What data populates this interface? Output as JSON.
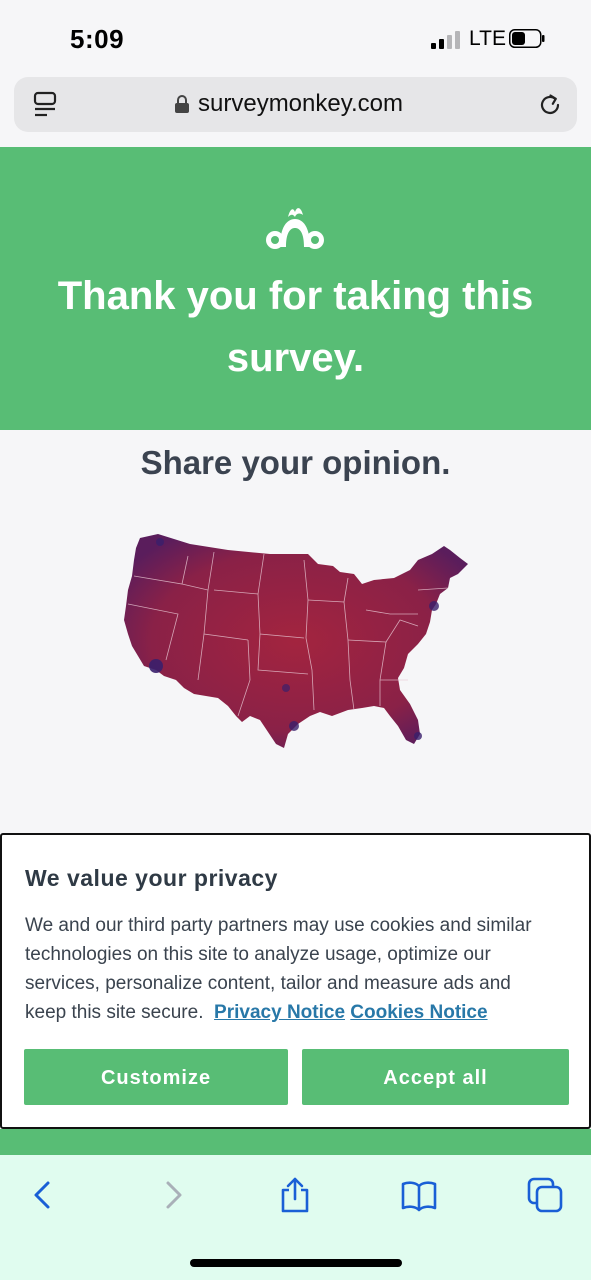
{
  "status_bar": {
    "time": "5:09",
    "network": "LTE"
  },
  "browser": {
    "url": "surveymonkey.com",
    "icons": [
      "reader-icon",
      "lock-icon",
      "reload-icon"
    ]
  },
  "hero": {
    "logo": "surveymonkey-logo-icon",
    "title": "Thank you for taking this survey.",
    "background": "#58bd75"
  },
  "main": {
    "share_title": "Share your opinion.",
    "image": "us-map-illustration"
  },
  "privacy": {
    "title": "We value your privacy",
    "body": "We and our third party partners may use cookies and similar technologies on this site to analyze usage, optimize our services, personalize content, tailor and measure ads and keep this site secure.",
    "privacy_link": "Privacy Notice",
    "cookies_link": "Cookies Notice",
    "customize_label": "Customize",
    "accept_label": "Accept all",
    "button_color": "#58bd75",
    "link_color": "#2878a8"
  },
  "toolbar": {
    "icons": [
      "back-icon",
      "forward-icon",
      "share-icon",
      "bookmarks-icon",
      "tabs-icon"
    ],
    "background": "#e0fcef",
    "icon_color": "#1a5fd6"
  }
}
